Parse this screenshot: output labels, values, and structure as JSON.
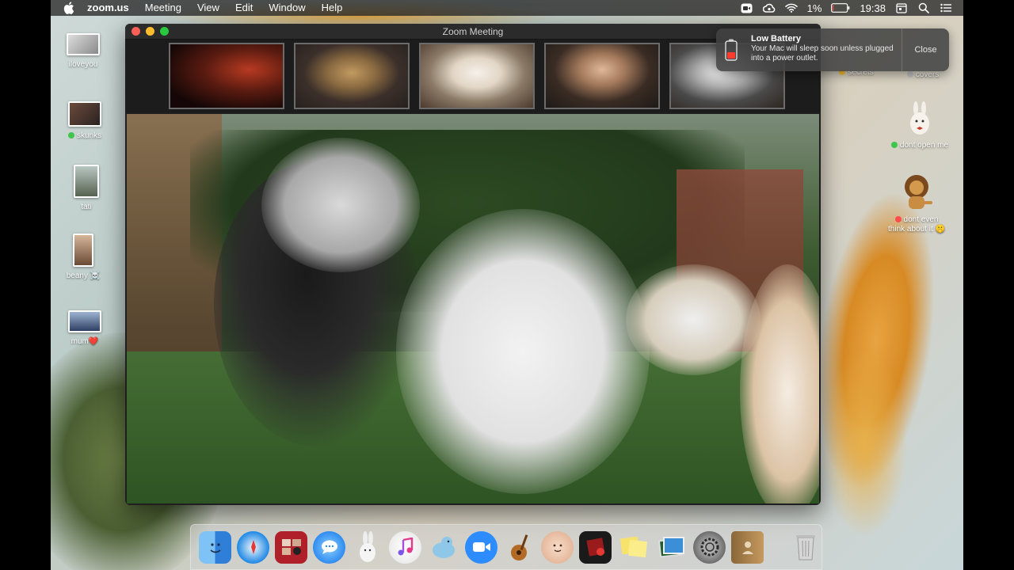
{
  "menubar": {
    "app_name": "zoom.us",
    "menus": [
      "Meeting",
      "View",
      "Edit",
      "Window",
      "Help"
    ],
    "battery_percent": "1%",
    "time": "19:38"
  },
  "desktop": {
    "left_icons": [
      {
        "label": "iloveyou"
      },
      {
        "label": "skunks"
      },
      {
        "label": "tati"
      },
      {
        "label": "beany ☠️"
      },
      {
        "label": "mum❤️"
      }
    ],
    "right_icons": [
      {
        "label": "secrets"
      },
      {
        "label": "covers"
      },
      {
        "label": "dont open me"
      },
      {
        "label_line1": "dont even",
        "label_line2": "think about it 🤫"
      }
    ]
  },
  "zoom": {
    "window_title": "Zoom Meeting",
    "participants": [
      {
        "icon": "person-video-tile"
      },
      {
        "icon": "dog-video-tile"
      },
      {
        "icon": "dog-video-tile"
      },
      {
        "icon": "person-video-tile"
      },
      {
        "icon": "husky-video-tile"
      }
    ]
  },
  "notification": {
    "title": "Low Battery",
    "message": "Your Mac will sleep soon unless plugged into a power outlet.",
    "close_label": "Close"
  },
  "dock": {
    "apps": [
      {
        "name": "finder-icon",
        "color": "#3d9bf0"
      },
      {
        "name": "safari-icon",
        "color": "#1e88e5"
      },
      {
        "name": "photo-booth-icon",
        "color": "#b0202a"
      },
      {
        "name": "messages-icon",
        "color": "#3fa0f5"
      },
      {
        "name": "rabbit-app-icon",
        "color": "#dde3e6"
      },
      {
        "name": "itunes-icon",
        "color": "#f4f4f4"
      },
      {
        "name": "seal-app-icon",
        "color": "#8fc7e8"
      },
      {
        "name": "zoom-icon",
        "color": "#2d8cff"
      },
      {
        "name": "garageband-icon",
        "color": "#f0a33a"
      },
      {
        "name": "face-app-icon",
        "color": "#f2d2bc"
      },
      {
        "name": "photo-app-icon",
        "color": "#9a1b1b"
      },
      {
        "name": "stickies-icon",
        "color": "#f7e36b"
      },
      {
        "name": "preview-icon",
        "color": "#2f7d3f"
      },
      {
        "name": "system-preferences-icon",
        "color": "#8c8c8c"
      },
      {
        "name": "contacts-icon",
        "color": "#a5814f"
      },
      {
        "name": "trash-icon",
        "color": "#c9c9c9"
      }
    ]
  }
}
